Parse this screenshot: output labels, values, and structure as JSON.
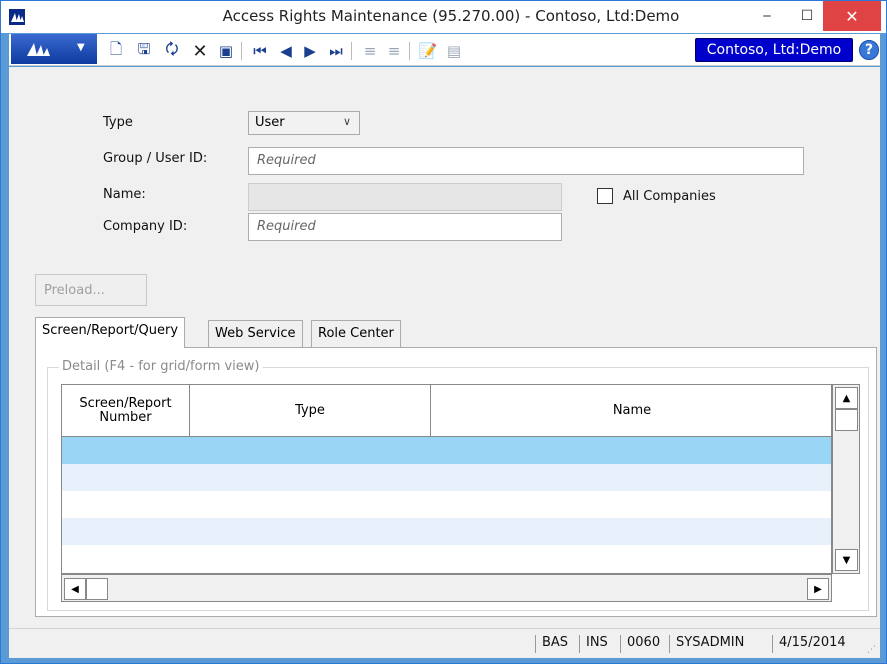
{
  "window": {
    "title": "Access Rights Maintenance (95.270.00) - Contoso, Ltd:Demo",
    "minimize": "‒",
    "maximize": "☐",
    "close": "✕"
  },
  "toolbar": {
    "company_button": "Contoso, Ltd:Demo",
    "help": "?"
  },
  "form": {
    "type_label": "Type",
    "type_value": "User",
    "group_user_id_label": "Group / User ID:",
    "group_user_id_placeholder": "Required",
    "name_label": "Name:",
    "name_value": "",
    "all_companies_label": "All Companies",
    "company_id_label": "Company ID:",
    "company_id_placeholder": "Required",
    "preload_button": "Preload..."
  },
  "tabs": [
    {
      "label": "Screen/Report/Query",
      "active": true
    },
    {
      "label": "Web Service",
      "active": false
    },
    {
      "label": "Role Center",
      "active": false
    }
  ],
  "detail": {
    "legend": "Detail (F4 - for grid/form view)",
    "columns": [
      "Screen/Report Number",
      "Type",
      "Name"
    ],
    "rows": [
      {
        "selected": true
      },
      {
        "selected": false
      },
      {
        "selected": false
      },
      {
        "selected": false
      },
      {
        "selected": false
      }
    ]
  },
  "statusbar": {
    "mode1": "BAS",
    "mode2": "INS",
    "code": "0060",
    "user": "SYSADMIN",
    "date": "4/15/2014"
  },
  "colors": {
    "company_button_bg": "#0000cc",
    "selected_row": "#99d5f5",
    "alt_row": "#e8f0fc",
    "close_button": "#e04343"
  }
}
